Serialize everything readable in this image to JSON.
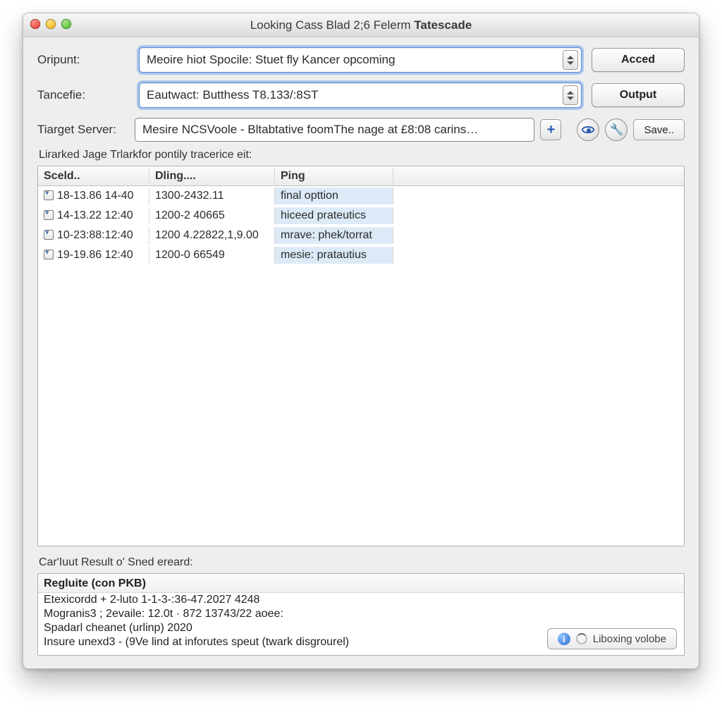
{
  "window": {
    "title_prefix": "Looking Cass Blad ",
    "title_mid": "2;6 Felerm ",
    "title_bold": "Tatescade"
  },
  "form": {
    "oripunt_label": "Oripunt:",
    "oripunt_value": "Meoire hiot Spocile: Stuet fly Kancer opcoming",
    "tancefie_label": "Tancefie:",
    "tancefie_value": "Eautwact: Butthess T8.133/:8ST",
    "target_label": "Tiarget Server:",
    "target_value": "Mesire NCSVoole - Bltabtative foomThe nage at £8:08 carins…"
  },
  "buttons": {
    "acced": "Acced",
    "output": "Output",
    "plus": "+",
    "save": "Save..",
    "footer": "Liboxing volobe"
  },
  "subheader": "Lirarked Jage Trlarkfor pontily tracerice eit:",
  "table": {
    "headers": [
      "Sceld..",
      "Dling....",
      "Ping",
      ""
    ],
    "rows": [
      {
        "c0": "18-13.86 14-40",
        "c1": "1300-2432.11",
        "c2": "final opttion"
      },
      {
        "c0": "14-13.22 12:40",
        "c1": "1200-2 40665",
        "c2": "hiceed prateutics"
      },
      {
        "c0": "10-23:88:12:40",
        "c1": "1200 4.22822,1,9.00",
        "c2": "mrave: phek/torrat"
      },
      {
        "c0": "19-19.86 12:40",
        "c1": "1200-0 66549",
        "c2": "mesie: pratautius"
      }
    ]
  },
  "results": {
    "label": "Car'Iuut Result o' Sned ereard:",
    "header": "Regluite (con PKB)",
    "lines": [
      "Etexicordd   + 2-luto 1-1-3-:36-47.2027 4248",
      "Mogranis3 ; 2evaile: 12.0t · 872 13743/22 aoee:",
      "Spadarl cheanet (urlinp) 2020",
      "Insure unexd3 - (9Ve lind at inforutes speut (twark disgrourel)"
    ]
  }
}
